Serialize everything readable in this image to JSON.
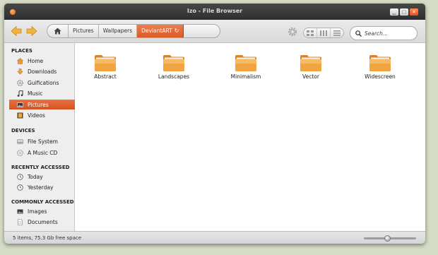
{
  "window": {
    "title": "Izo - File Browser"
  },
  "colors": {
    "accent": "#e2602a",
    "folder": "#f0a542",
    "titlebar": "#3b3b3b"
  },
  "toolbar": {
    "back_icon": "back-arrow-icon",
    "forward_icon": "forward-arrow-icon",
    "path": [
      {
        "label": "",
        "icon": "home-icon"
      },
      {
        "label": "Pictures"
      },
      {
        "label": "Wallpapers"
      },
      {
        "label": "DeviantART",
        "active": true,
        "icon": "reload-icon"
      }
    ],
    "view_modes": [
      "icon-view",
      "compact-view",
      "list-view"
    ],
    "search_placeholder": "Search..."
  },
  "sidebar": {
    "places_header": "PLACES",
    "places": [
      {
        "label": "Home",
        "icon": "home-folder-icon"
      },
      {
        "label": "Downloads",
        "icon": "downloads-icon"
      },
      {
        "label": "Guifications",
        "icon": "gear-folder-icon"
      },
      {
        "label": "Music",
        "icon": "music-icon"
      },
      {
        "label": "Pictures",
        "icon": "pictures-icon",
        "selected": true
      },
      {
        "label": "Videos",
        "icon": "videos-icon"
      }
    ],
    "devices_header": "DEVICES",
    "devices": [
      {
        "label": "File System",
        "icon": "harddisk-icon"
      },
      {
        "label": "A Music CD",
        "icon": "cd-icon"
      }
    ],
    "recent_header": "RECENTLY ACCESSED",
    "recent": [
      {
        "label": "Today",
        "icon": "clock-icon"
      },
      {
        "label": "Yesterday",
        "icon": "clock-icon"
      }
    ],
    "common_header": "COMMONLY ACCESSED",
    "common": [
      {
        "label": "Images",
        "icon": "images-icon"
      },
      {
        "label": "Documents",
        "icon": "documents-icon"
      }
    ]
  },
  "folders": [
    {
      "label": "Abstract"
    },
    {
      "label": "Landscapes"
    },
    {
      "label": "Minimalism"
    },
    {
      "label": "Vector"
    },
    {
      "label": "Widescreen"
    }
  ],
  "status": {
    "text": "5 items, 75.3 Gb free space",
    "zoom_fraction": 0.45
  }
}
